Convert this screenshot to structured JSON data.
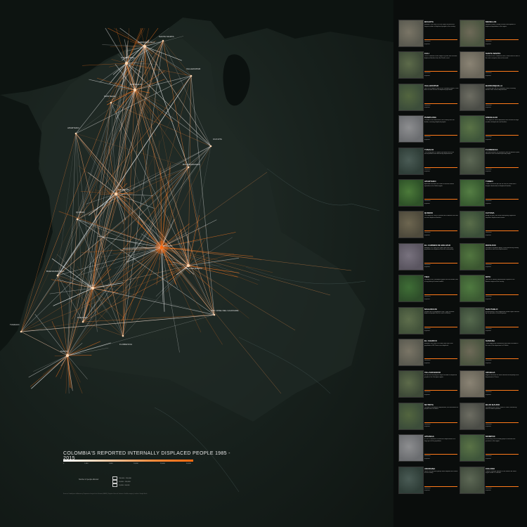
{
  "map": {
    "title": "COLOMBIA'S REPORTED INTERNALLY DISPLACED PEOPLE 1985 - 2015",
    "scale_ticks": [
      "0",
      "1,000",
      "5,000",
      "10,000",
      "25,000",
      "50,000"
    ],
    "legend_title": "Number of people affected",
    "legend_items": [
      "100,000 - 200,000",
      "50,000 - 100,000",
      "10,000 - 50,000"
    ],
    "credits": "Sources: Unidad para la Atencion y Reparacion Integral a las Victimas (UARIV), Registro Unico de Victimas. Satellite imagery: Landsat / Google Earth.",
    "colors": {
      "flow_origin": "#ffffff",
      "flow_destination": "#ff6a10",
      "sea": "#0f1512",
      "land": "#25302b"
    },
    "cities": [
      {
        "name": "BARRANQUILLA"
      },
      {
        "name": "SANTA MARTA"
      },
      {
        "name": "CARTAGENA"
      },
      {
        "name": "VALLEDUPAR"
      },
      {
        "name": "SINCELEJO"
      },
      {
        "name": "MONTERIA"
      },
      {
        "name": "APARTADO"
      },
      {
        "name": "CUCUTA"
      },
      {
        "name": "MEDELLIN"
      },
      {
        "name": "BUCARAMANGA"
      },
      {
        "name": "QUIBDO"
      },
      {
        "name": "BOGOTA"
      },
      {
        "name": "VILLAVICENCIO"
      },
      {
        "name": "BUENAVENTURA"
      },
      {
        "name": "CALI"
      },
      {
        "name": "POPAYAN"
      },
      {
        "name": "PASTO"
      },
      {
        "name": "TUMACO"
      },
      {
        "name": "FLORENCIA"
      },
      {
        "name": "SAN JOSE DEL GUAVIARE"
      }
    ]
  },
  "panel": {
    "cards": [
      {
        "title": "BOGOTA",
        "text": "Between 1985 and 2015 the capital received the largest number of displaced people in the country.",
        "stat1": "Received",
        "stat2": "Expelled"
      },
      {
        "title": "MEDELLIN",
        "text": "Medellin is both a major receiver and expeller of displaced population in the region.",
        "stat1": "Received",
        "stat2": "Expelled"
      },
      {
        "title": "CALI",
        "text": "Cali is Colombia's third largest city and has received displaced families from the Pacific coast.",
        "stat1": "Received",
        "stat2": "Expelled"
      },
      {
        "title": "SANTA MARTA",
        "text": "Located on the Caribbean coast, Santa Marta is one of the main reception cities in the north.",
        "stat1": "Received",
        "stat2": "Expelled"
      },
      {
        "title": "VALLEDUPAR",
        "text": "One of the largest cities of the Caribbean region, it has been a main receiver of displaced population.",
        "stat1": "Received",
        "stat2": "Expelled"
      },
      {
        "title": "BARRANQUILLA",
        "text": "The main port on the Caribbean coast, receiving families from several departments.",
        "stat1": "Received",
        "stat2": "Expelled"
      },
      {
        "title": "PAMPLONA",
        "text": "Located in the north-east of the country near the border, receiving displaced people.",
        "stat1": "Received",
        "stat2": "Expelled"
      },
      {
        "title": "SINCELEJO",
        "text": "The capital of Sucre department has received a large number of displaced rural families.",
        "stat1": "Received",
        "stat2": "Expelled"
      },
      {
        "title": "TUMACO",
        "text": "The Pacific port of Tumaco has been one of the municipalities most affected by displacement.",
        "stat1": "Received",
        "stat2": "Expelled"
      },
      {
        "title": "FLORENCIA",
        "text": "Located between the mountains and the Amazon plain, Florencia has received displaced people.",
        "stat1": "Received",
        "stat2": "Expelled"
      },
      {
        "title": "APARTADO",
        "text": "Apartado has been the centre of several violent episodes in the Uraba region.",
        "stat1": "Received",
        "stat2": "Expelled"
      },
      {
        "title": "TURBO",
        "text": "Turbo is the main port on the Gulf of Uraba and a frequent destination of displaced families.",
        "stat1": "Received",
        "stat2": "Expelled"
      },
      {
        "title": "QUIBDO",
        "text": "The capital of Choco is located on the Atrato river and receives displaced families.",
        "stat1": "Received",
        "stat2": "Expelled"
      },
      {
        "title": "CAYUNA",
        "text": "Along the river, this small municipality registered important displacement events.",
        "stat1": "Received",
        "stat2": "Expelled"
      },
      {
        "title": "EL CARMEN DE BOLIVAR",
        "text": "Between 1997 and 2002 more than half of the population was displaced from the municipality.",
        "stat1": "Received",
        "stat2": "Expelled"
      },
      {
        "title": "RIOSUCIO",
        "text": "Located in the Atrato basin, it was affected by military operations and mass displacement.",
        "stat1": "Received",
        "stat2": "Expelled"
      },
      {
        "title": "TIBU",
        "text": "Located in the Catatumbo region near the border, with a long history of armed conflict.",
        "stat1": "Received",
        "stat2": "Expelled"
      },
      {
        "title": "MITU",
        "text": "One of the smaller departmental capitals in the Amazon region of the country.",
        "stat1": "Received",
        "stat2": "Expelled"
      },
      {
        "title": "MAGANGUE",
        "text": "Situated on the Magdalena river, it has received displaced people from the south of Bolivar.",
        "stat1": "Received",
        "stat2": "Expelled"
      },
      {
        "title": "SAN PABLO",
        "text": "A municipality in the Magdalena Medio region affected by the presence of armed groups.",
        "stat1": "Received",
        "stat2": "Expelled"
      },
      {
        "title": "EL CHARCO",
        "text": "Between 2005 and 2015 more than half of the population of El Charco was displaced.",
        "stat1": "Received",
        "stat2": "Expelled"
      },
      {
        "title": "SAMANA",
        "text": "These significant movements have been recorded in the east of the department of Caldas.",
        "stat1": "Received",
        "stat2": "Expelled"
      },
      {
        "title": "VILLAVICENCIO",
        "text": "As well as receiving the largest number of displaced people in the Orinoquia region.",
        "stat1": "Received",
        "stat2": "Expelled"
      },
      {
        "title": "ARGELIA",
        "text": "Argelia has been the most affected municipality in the department of Cauca.",
        "stat1": "Received",
        "stat2": "Expelled"
      },
      {
        "title": "NUTRITA",
        "text": "Located in the Amazon department, the movements of people were recorded.",
        "stat1": "Received",
        "stat2": "Expelled"
      },
      {
        "title": "BAJO BAUDO",
        "text": "Located on the Pacific coast of Choco, affected by several violent episodes.",
        "stat1": "Received",
        "stat2": "Expelled"
      },
      {
        "title": "APIANGA",
        "text": "In 2001 a massacre caused the displacement of a large part of the population.",
        "stat1": "Received",
        "stat2": "Expelled"
      },
      {
        "title": "MOMPOX",
        "text": "In the early 2000s armed groups increased their presence in the region.",
        "stat1": "Received",
        "stat2": "Expelled"
      },
      {
        "title": "ANORANA",
        "text": "Since 2000 guerrilla groups have disputed the control of the territory.",
        "stat1": "Received",
        "stat2": "Expelled"
      },
      {
        "title": "COLOSO",
        "text": "Colosos strategic position in the Montes de Maria region made it a corridor.",
        "stat1": "Received",
        "stat2": "Expelled"
      }
    ]
  }
}
